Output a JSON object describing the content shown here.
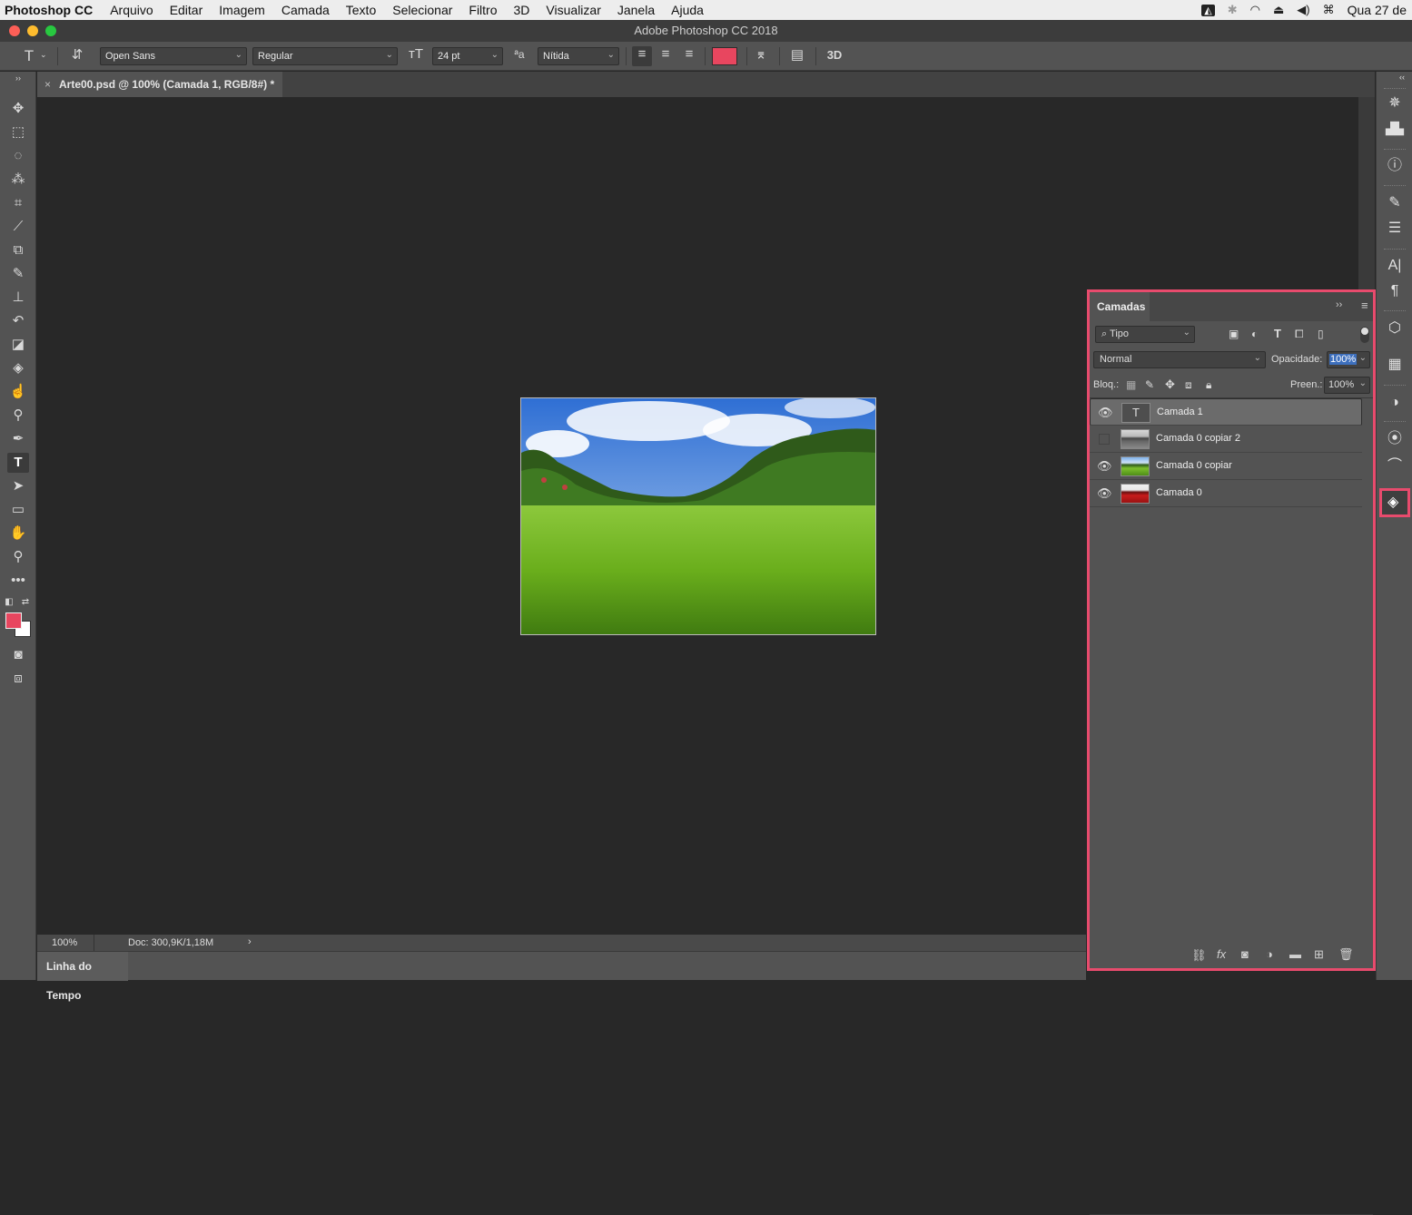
{
  "menubar": {
    "app": "Photoshop CC",
    "items": [
      "Arquivo",
      "Editar",
      "Imagem",
      "Camada",
      "Texto",
      "Selecionar",
      "Filtro",
      "3D",
      "Visualizar",
      "Janela",
      "Ajuda"
    ],
    "date": "Qua 27 de"
  },
  "window": {
    "title": "Adobe Photoshop CC 2018"
  },
  "options": {
    "tool_glyph": "T",
    "font_family": "Open Sans",
    "font_style": "Regular",
    "font_size": "24 pt",
    "antialias": "Nítida",
    "text_color": "#e8465f",
    "three_d_label": "3D"
  },
  "document": {
    "tab_title": "Arte00.psd @ 100% (Camada 1, RGB/8#) *",
    "zoom": "100%",
    "doc_info": "Doc: 300,9K/1,18M"
  },
  "timeline": {
    "label": "Linha do Tempo"
  },
  "layers_panel": {
    "title": "Camadas",
    "filter_label": "Tipo",
    "blend_mode": "Normal",
    "opacity_label": "Opacidade:",
    "opacity_value": "100%",
    "lock_label": "Bloq.:",
    "fill_label": "Preen.:",
    "fill_value": "100%",
    "layers": [
      {
        "name": "Camada 1",
        "visible": true,
        "selected": true,
        "kind": "text"
      },
      {
        "name": "Camada 0 copiar 2",
        "visible": false,
        "selected": false,
        "kind": "grayscale"
      },
      {
        "name": "Camada 0 copiar",
        "visible": true,
        "selected": false,
        "kind": "color"
      },
      {
        "name": "Camada 0",
        "visible": true,
        "selected": false,
        "kind": "red"
      }
    ]
  },
  "colors": {
    "foreground": "#e8465f",
    "background": "#ffffff",
    "highlight": "#e84b6d"
  }
}
